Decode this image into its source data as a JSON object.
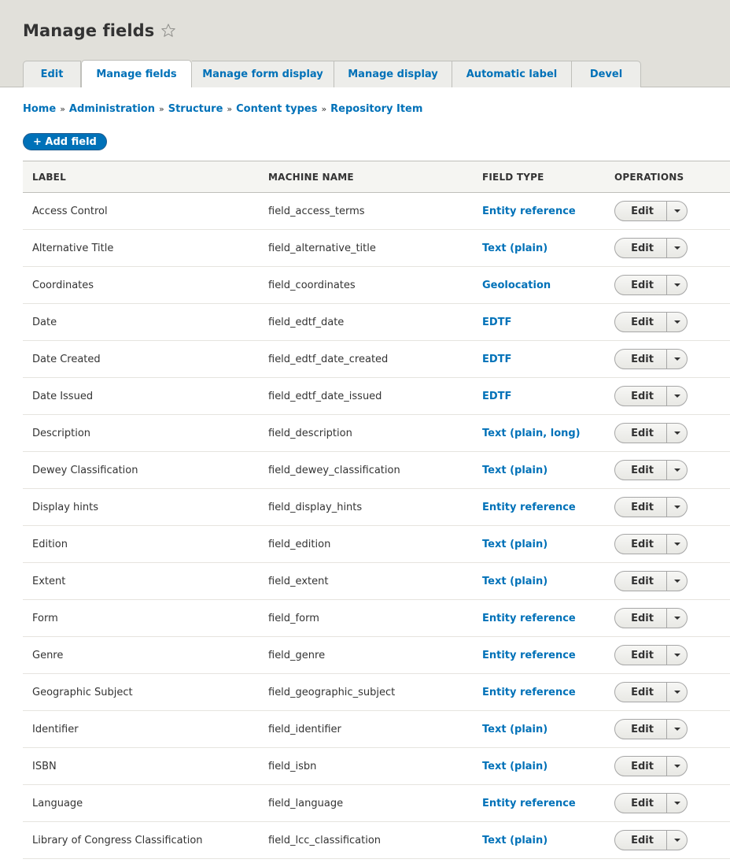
{
  "page": {
    "title": "Manage fields",
    "star_icon": "star-outline-icon"
  },
  "tabs": [
    {
      "label": "Edit",
      "active": false
    },
    {
      "label": "Manage fields",
      "active": true
    },
    {
      "label": "Manage form display",
      "active": false
    },
    {
      "label": "Manage display",
      "active": false
    },
    {
      "label": "Automatic label",
      "active": false
    },
    {
      "label": "Devel",
      "active": false
    }
  ],
  "breadcrumb": {
    "separator": "»",
    "items": [
      "Home",
      "Administration",
      "Structure",
      "Content types",
      "Repository Item"
    ]
  },
  "add_field": {
    "label": "+ Add field"
  },
  "table": {
    "headers": [
      "Label",
      "Machine name",
      "Field type",
      "Operations"
    ],
    "operation_label": "Edit",
    "rows": [
      {
        "label": "Access Control",
        "machine_name": "field_access_terms",
        "field_type": "Entity reference"
      },
      {
        "label": "Alternative Title",
        "machine_name": "field_alternative_title",
        "field_type": "Text (plain)"
      },
      {
        "label": "Coordinates",
        "machine_name": "field_coordinates",
        "field_type": "Geolocation"
      },
      {
        "label": "Date",
        "machine_name": "field_edtf_date",
        "field_type": "EDTF"
      },
      {
        "label": "Date Created",
        "machine_name": "field_edtf_date_created",
        "field_type": "EDTF"
      },
      {
        "label": "Date Issued",
        "machine_name": "field_edtf_date_issued",
        "field_type": "EDTF"
      },
      {
        "label": "Description",
        "machine_name": "field_description",
        "field_type": "Text (plain, long)"
      },
      {
        "label": "Dewey Classification",
        "machine_name": "field_dewey_classification",
        "field_type": "Text (plain)"
      },
      {
        "label": "Display hints",
        "machine_name": "field_display_hints",
        "field_type": "Entity reference"
      },
      {
        "label": "Edition",
        "machine_name": "field_edition",
        "field_type": "Text (plain)"
      },
      {
        "label": "Extent",
        "machine_name": "field_extent",
        "field_type": "Text (plain)"
      },
      {
        "label": "Form",
        "machine_name": "field_form",
        "field_type": "Entity reference"
      },
      {
        "label": "Genre",
        "machine_name": "field_genre",
        "field_type": "Entity reference"
      },
      {
        "label": "Geographic Subject",
        "machine_name": "field_geographic_subject",
        "field_type": "Entity reference"
      },
      {
        "label": "Identifier",
        "machine_name": "field_identifier",
        "field_type": "Text (plain)"
      },
      {
        "label": "ISBN",
        "machine_name": "field_isbn",
        "field_type": "Text (plain)"
      },
      {
        "label": "Language",
        "machine_name": "field_language",
        "field_type": "Entity reference"
      },
      {
        "label": "Library of Congress Classification",
        "machine_name": "field_lcc_classification",
        "field_type": "Text (plain)"
      }
    ]
  },
  "colors": {
    "link": "#0071b8",
    "header_bg": "#e1e0da",
    "text": "#333333"
  }
}
